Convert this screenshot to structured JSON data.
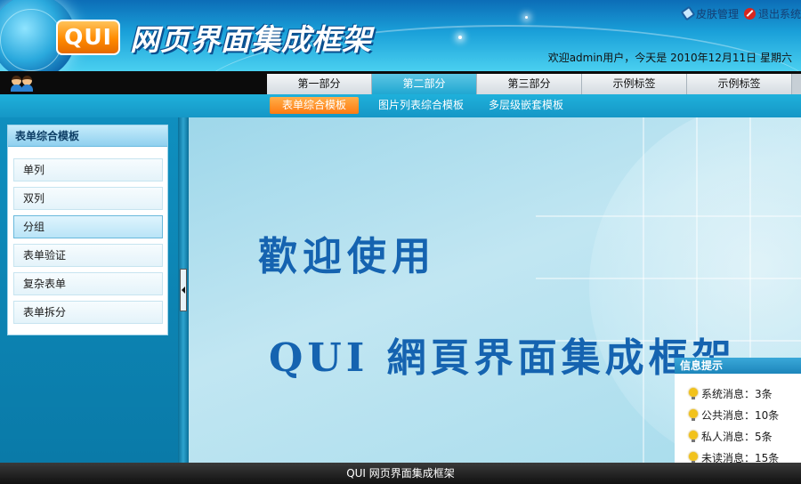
{
  "header": {
    "logo_badge": "QUI",
    "logo_title": "网页界面集成框架",
    "links": [
      {
        "label": "皮肤管理",
        "icon": "skin-icon"
      },
      {
        "label": "退出系统",
        "icon": "exit-icon"
      }
    ],
    "welcome": "欢迎admin用户，今天是 2010年12月11日 星期六"
  },
  "nav": {
    "user_icon": "users-icon",
    "tabs": [
      {
        "label": "第一部分",
        "active": false
      },
      {
        "label": "第二部分",
        "active": true
      },
      {
        "label": "第三部分",
        "active": false
      },
      {
        "label": "示例标签",
        "active": false
      },
      {
        "label": "示例标签",
        "active": false
      }
    ]
  },
  "subnav": {
    "items": [
      {
        "label": "表单综合模板",
        "active": true
      },
      {
        "label": "图片列表综合模板",
        "active": false
      },
      {
        "label": "多层级嵌套模板",
        "active": false
      }
    ]
  },
  "sidebar": {
    "title": "表单综合模板",
    "items": [
      {
        "label": "单列",
        "active": false
      },
      {
        "label": "双列",
        "active": false
      },
      {
        "label": "分组",
        "active": true
      },
      {
        "label": "表单验证",
        "active": false
      },
      {
        "label": "复杂表单",
        "active": false
      },
      {
        "label": "表单拆分",
        "active": false
      }
    ]
  },
  "main": {
    "welcome_text": "歡迎使用",
    "framework_text": "QUI 網頁界面集成框架"
  },
  "info_panel": {
    "title": "信息提示",
    "items": [
      {
        "label": "系统消息：3条",
        "icon": "bulb-icon"
      },
      {
        "label": "公共消息：10条",
        "icon": "bulb-icon"
      },
      {
        "label": "私人消息：5条",
        "icon": "bulb-icon"
      },
      {
        "label": "未读消息：15条",
        "icon": "bulb-icon"
      }
    ]
  },
  "footer": {
    "text": "QUI 网页界面集成框架"
  },
  "colors": {
    "header_blue": "#1aa0d9",
    "active_tab": "#20a7d1",
    "active_subtab": "#ff7b10",
    "footer": "#111111"
  }
}
